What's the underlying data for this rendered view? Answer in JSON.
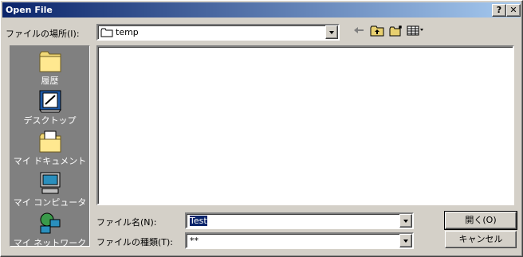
{
  "window": {
    "title": "Open File"
  },
  "titlebar_buttons": {
    "help": "?",
    "close": "✕"
  },
  "lookin": {
    "label": "ファイルの場所(I):",
    "value": "temp"
  },
  "places": [
    {
      "label": "履歴",
      "icon": "history-folder-icon"
    },
    {
      "label": "デスクトップ",
      "icon": "desktop-icon"
    },
    {
      "label": "マイ ドキュメント",
      "icon": "my-documents-icon"
    },
    {
      "label": "マイ コンピュータ",
      "icon": "my-computer-icon"
    },
    {
      "label": "マイ ネットワーク",
      "icon": "my-network-icon"
    }
  ],
  "filename": {
    "label": "ファイル名(N):",
    "value": "Test"
  },
  "filetype": {
    "label": "ファイルの種類(T):",
    "value": "**"
  },
  "buttons": {
    "open": "開く(O)",
    "cancel": "キャンセル"
  },
  "colors": {
    "title_start": "#0a246a",
    "title_end": "#a6caf0",
    "face": "#d4d0c8",
    "places_bg": "#808080"
  }
}
